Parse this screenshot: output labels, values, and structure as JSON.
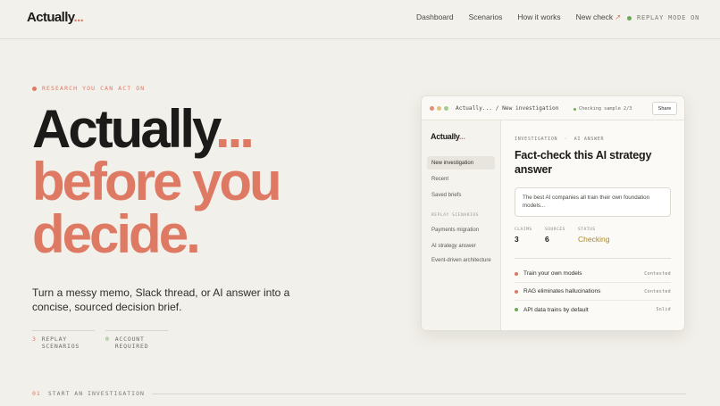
{
  "nav": {
    "logo": "Actually",
    "logo_dots": "...",
    "links": [
      "Dashboard",
      "Scenarios",
      "How it works"
    ],
    "new_check": "New check",
    "new_check_arrow": "↗",
    "replay_mode": "REPLAY MODE ON"
  },
  "hero": {
    "eyebrow": "RESEARCH YOU CAN ACT ON",
    "title_line1": "Actually",
    "title_dots": "...",
    "title_line2": "before you",
    "title_line3": "decide.",
    "subtitle": "Turn a messy memo, Slack thread, or AI answer into a concise, sourced decision brief.",
    "stats": [
      {
        "num": "3",
        "label": "REPLAY SCENARIOS"
      },
      {
        "num": "0",
        "label": "ACCOUNT REQUIRED"
      }
    ]
  },
  "footer": {
    "index": "01",
    "label": "START AN INVESTIGATION"
  },
  "app": {
    "crumb": "Actually... / New investigation",
    "checking": "Checking sample 2/3",
    "share": "Share",
    "sidebar": {
      "logo": "Actually",
      "logo_dots": "...",
      "items": [
        "New investigation",
        "Recent",
        "Saved briefs"
      ],
      "section": "REPLAY SCENARIOS",
      "scenarios": [
        "Payments migration",
        "AI strategy answer",
        "Event-driven architecture"
      ]
    },
    "main": {
      "eyebrow": "INVESTIGATION  ·  AI ANSWER",
      "title": "Fact-check this AI strategy answer",
      "quote": "The best AI companies all train their own foundation models...",
      "metrics": [
        {
          "label": "CLAIMS",
          "value": "3"
        },
        {
          "label": "SOURCES",
          "value": "6"
        },
        {
          "label": "STATUS",
          "value": "Checking"
        }
      ],
      "claims": [
        {
          "text": "Train your own models",
          "verdict": "Contested",
          "color": "#de7a64"
        },
        {
          "text": "RAG eliminates hallucinations",
          "verdict": "Contested",
          "color": "#de7a64"
        },
        {
          "text": "API data trains by default",
          "verdict": "Solid",
          "color": "#6ea85a"
        }
      ]
    }
  },
  "colors": {
    "accent": "#de7a64",
    "success": "#6ea85a",
    "background": "#f2f0ea"
  }
}
